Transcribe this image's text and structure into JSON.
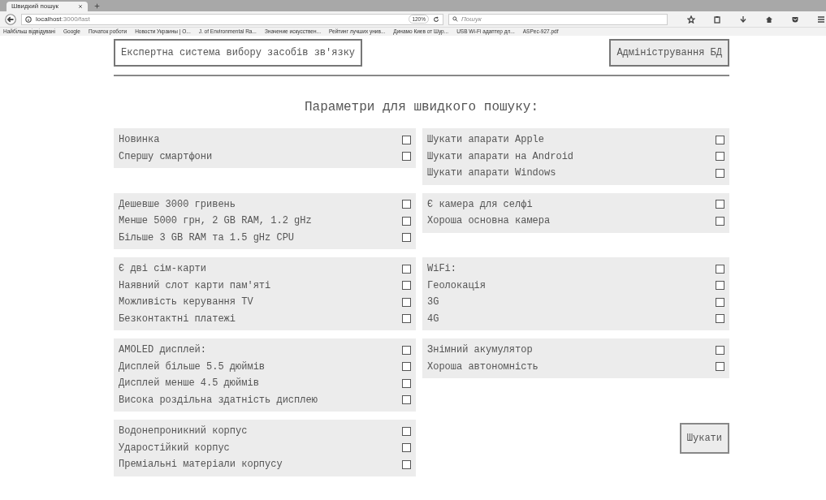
{
  "browser": {
    "tab_title": "Швидкий пошук",
    "url_host": "localhost",
    "url_path": ":3000/fast",
    "zoom": "120%",
    "search_placeholder": "Пошук",
    "bookmarks": [
      "Найбільш відвідувані",
      "Google",
      "Початок роботи",
      "Новости Украины | О...",
      "J. of Environmental Ra...",
      "Значение искусствен...",
      "Рейтинг лучших унив...",
      "Динамо Киев от Шур...",
      "USB Wi-Fi адаптер дл...",
      "ASPec-927.pdf"
    ]
  },
  "header": {
    "title": "Експертна система вибору засобів зв'язку",
    "admin_button": "Адміністрування БД"
  },
  "heading": "Параметри для швидкого пошуку:",
  "rows": [
    {
      "groups": [
        {
          "items": [
            {
              "label": "Новинка",
              "checked": false
            },
            {
              "label": "Спершу смартфони",
              "checked": false
            }
          ]
        },
        {
          "items": [
            {
              "label": "Шукати апарати Apple",
              "checked": false
            },
            {
              "label": "Шукати апарати на Android",
              "checked": false
            },
            {
              "label": "Шукати апарати Windows",
              "checked": false
            }
          ]
        }
      ]
    },
    {
      "groups": [
        {
          "items": [
            {
              "label": "Дешевше 3000 гривень",
              "checked": false
            },
            {
              "label": "Менше 5000 грн, 2 GB RAM, 1.2 gHz",
              "checked": false
            },
            {
              "label": "Більше 3 GB RAM та 1.5 gHz CPU",
              "checked": false
            }
          ]
        },
        {
          "items": [
            {
              "label": "Є камера для селфі",
              "checked": false
            },
            {
              "label": "Хороша основна камера",
              "checked": false
            }
          ]
        }
      ]
    },
    {
      "groups": [
        {
          "items": [
            {
              "label": "Є дві сім-карти",
              "checked": false
            },
            {
              "label": "Наявний слот карти пам'яті",
              "checked": false
            },
            {
              "label": "Можливість керування TV",
              "checked": false
            },
            {
              "label": "Безконтактні платежі",
              "checked": false
            }
          ]
        },
        {
          "items": [
            {
              "label": "WiFi:",
              "checked": false
            },
            {
              "label": "Геолокація",
              "checked": false
            },
            {
              "label": "3G",
              "checked": false
            },
            {
              "label": "4G",
              "checked": false
            }
          ]
        }
      ]
    },
    {
      "groups": [
        {
          "items": [
            {
              "label": "AMOLED дисплей:",
              "checked": false
            },
            {
              "label": "Дисплей більше 5.5 дюймів",
              "checked": false
            },
            {
              "label": "Дисплей менше 4.5 дюймів",
              "checked": false
            },
            {
              "label": "Висока роздільна здатність дисплею",
              "checked": false
            }
          ]
        },
        {
          "items": [
            {
              "label": "Знімний акумулятор",
              "checked": false
            },
            {
              "label": "Хороша автономність",
              "checked": false
            }
          ]
        }
      ]
    },
    {
      "groups": [
        {
          "items": [
            {
              "label": "Водонепроникний корпус",
              "checked": false
            },
            {
              "label": "Ударостійкий корпус",
              "checked": false
            },
            {
              "label": "Преміальні матеріали корпусу",
              "checked": false
            }
          ]
        }
      ]
    }
  ],
  "search_button": "Шукати"
}
